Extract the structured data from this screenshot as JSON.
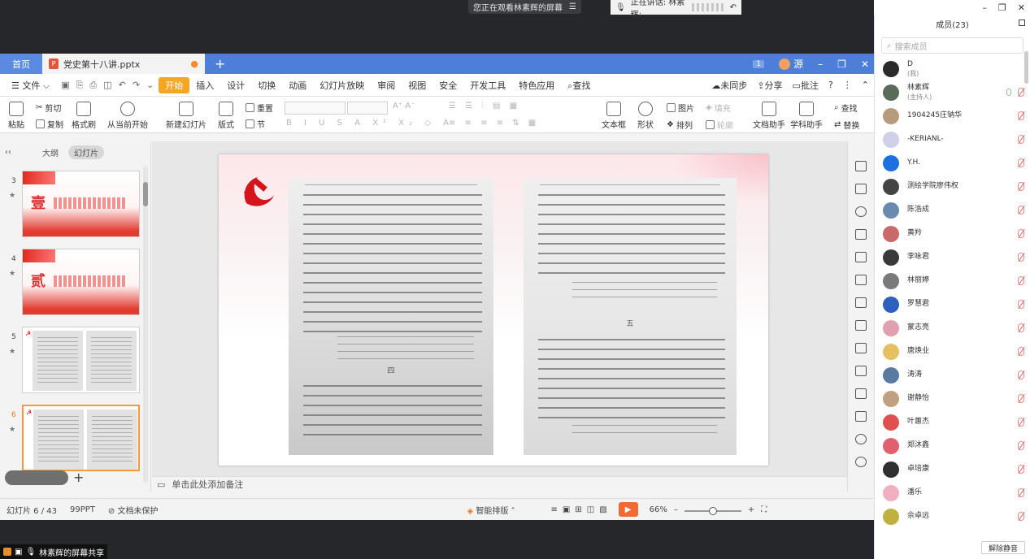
{
  "meeting": {
    "notice": "您正在观看林素辉的屏幕",
    "speaking": "正在讲话: 林素辉;",
    "share_label": "林素辉的屏幕共享"
  },
  "tabs": {
    "home": "首页",
    "doc": "党史第十八讲.pptx",
    "badge": "1",
    "right_text": "源"
  },
  "menu": {
    "file": "文件",
    "items": [
      "开始",
      "插入",
      "设计",
      "切换",
      "动画",
      "幻灯片放映",
      "审阅",
      "视图",
      "安全",
      "开发工具",
      "特色应用"
    ],
    "search": "查找",
    "sync": "未同步",
    "share": "分享",
    "comment": "批注"
  },
  "ribbon": {
    "paste": "粘贴",
    "cut": "剪切",
    "copy": "复制",
    "format_painter": "格式刷",
    "from_current": "从当前开始",
    "new_slide": "新建幻灯片",
    "layout": "版式",
    "reset": "重置",
    "section": "节",
    "textbox": "文本框",
    "shape": "形状",
    "picture": "图片",
    "fill": "填充",
    "arrange": "排列",
    "outline": "轮廓",
    "doc_assistant": "文档助手",
    "study_assistant": "学科助手",
    "find": "查找",
    "replace": "替换"
  },
  "left_panel": {
    "outline_tab": "大纲",
    "slides_tab": "幻灯片",
    "thumbs": [
      {
        "num": "3",
        "glyph": "壹"
      },
      {
        "num": "4",
        "glyph": "贰"
      },
      {
        "num": "5",
        "glyph": ""
      },
      {
        "num": "6",
        "glyph": ""
      }
    ]
  },
  "slide": {
    "left_page_section": "四",
    "right_page_section": "五"
  },
  "notes": {
    "placeholder": "单击此处添加备注"
  },
  "status": {
    "slide_count": "幻灯片 6 / 43",
    "theme": "99PPT",
    "protect": "文档未保护",
    "smart_layout": "智能排版",
    "zoom": "66%"
  },
  "members": {
    "title": "成员(23)",
    "search_placeholder": "搜索成员",
    "unmute_all": "解除静音",
    "list": [
      {
        "name": "D",
        "sub": "(我)",
        "color": "#2b2b2b"
      },
      {
        "name": "林素辉",
        "sub": "(主持人)",
        "color": "#5a6b5a"
      },
      {
        "name": "1904245庄钠华",
        "sub": "",
        "color": "#b89b7a"
      },
      {
        "name": "-KERIANL-",
        "sub": "",
        "color": "#d0d0e8"
      },
      {
        "name": "Y.H.",
        "sub": "",
        "color": "#1e6fe0"
      },
      {
        "name": "测绘学院廖伟权",
        "sub": "",
        "color": "#444444"
      },
      {
        "name": "陈浩成",
        "sub": "",
        "color": "#6a8ab0"
      },
      {
        "name": "黄羚",
        "sub": "",
        "color": "#c96a6a"
      },
      {
        "name": "李咏君",
        "sub": "",
        "color": "#3a3a3a"
      },
      {
        "name": "林丽婷",
        "sub": "",
        "color": "#7a7a7a"
      },
      {
        "name": "罗慧君",
        "sub": "",
        "color": "#2d5fbf"
      },
      {
        "name": "蒙志亮",
        "sub": "",
        "color": "#e0a0b0"
      },
      {
        "name": "唐焕业",
        "sub": "",
        "color": "#e6c060"
      },
      {
        "name": "涛涛",
        "sub": "",
        "color": "#5a7aa0"
      },
      {
        "name": "谢静怡",
        "sub": "",
        "color": "#c0a080"
      },
      {
        "name": "叶蕙杰",
        "sub": "",
        "color": "#e05050"
      },
      {
        "name": "郑沐鑫",
        "sub": "",
        "color": "#e06070"
      },
      {
        "name": "卓培康",
        "sub": "",
        "color": "#303030"
      },
      {
        "name": "潘乐",
        "sub": "",
        "color": "#f0b0c0"
      },
      {
        "name": "佘卓远",
        "sub": "",
        "color": "#c0b040"
      }
    ]
  }
}
